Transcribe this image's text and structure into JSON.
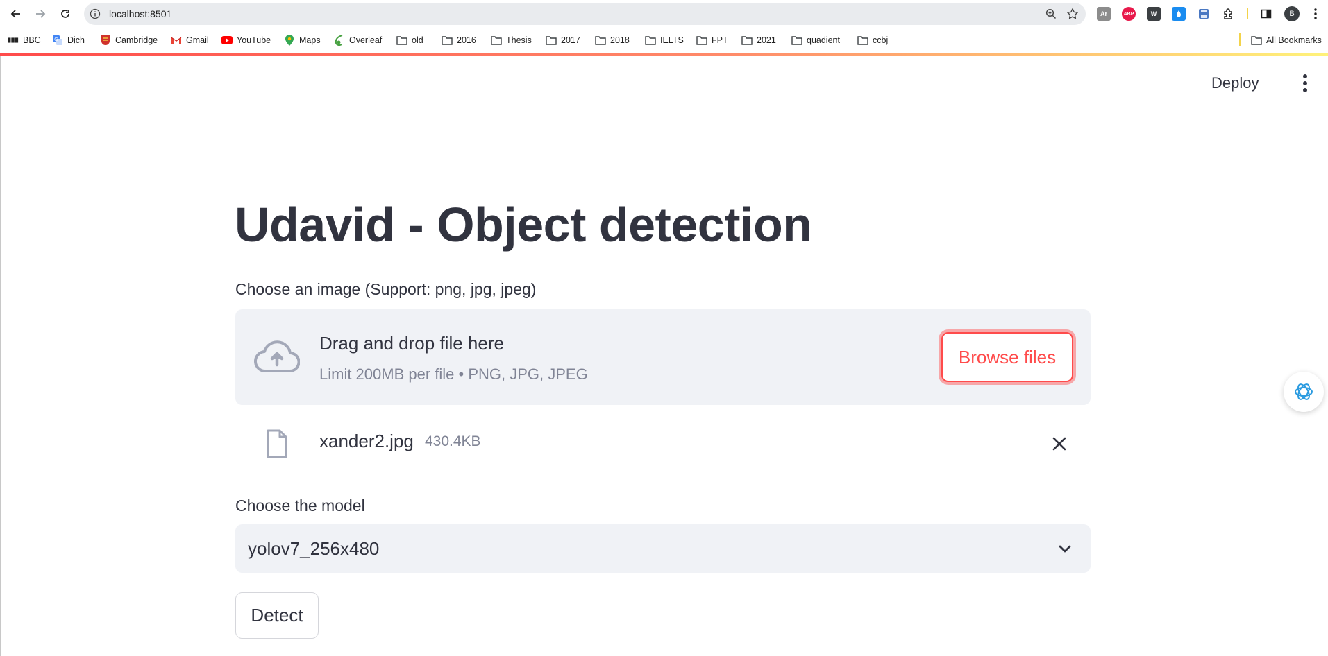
{
  "browser": {
    "url": "localhost:8501",
    "profile_initial": "B",
    "extensions": [
      {
        "name": "acrobat-extension-icon",
        "label": "Ar",
        "color": "#5f6368"
      },
      {
        "name": "adblock-plus-extension-icon",
        "label": "ABP",
        "color": "#e8194b"
      },
      {
        "name": "w-extension-icon",
        "label": "W",
        "color": "#3c4043"
      },
      {
        "name": "dropper-extension-icon",
        "label": "💧",
        "color": "#1a8cf0"
      },
      {
        "name": "save-extension-icon",
        "label": "💾",
        "color": "#4a78c2"
      }
    ],
    "bookmarks": [
      {
        "label": "BBC",
        "icon": "bbc-icon"
      },
      {
        "label": "Dịch",
        "icon": "translate-icon"
      },
      {
        "label": "Cambridge",
        "icon": "cambridge-icon"
      },
      {
        "label": "Gmail",
        "icon": "gmail-icon"
      },
      {
        "label": "YouTube",
        "icon": "youtube-icon"
      },
      {
        "label": "Maps",
        "icon": "maps-icon"
      },
      {
        "label": "Overleaf",
        "icon": "overleaf-icon"
      },
      {
        "label": "old",
        "icon": "folder-icon"
      },
      {
        "label": "2016",
        "icon": "folder-icon"
      },
      {
        "label": "Thesis",
        "icon": "folder-icon"
      },
      {
        "label": "2017",
        "icon": "folder-icon"
      },
      {
        "label": "2018",
        "icon": "folder-icon"
      },
      {
        "label": "IELTS",
        "icon": "folder-icon"
      },
      {
        "label": "FPT",
        "icon": "folder-icon"
      },
      {
        "label": "2021",
        "icon": "folder-icon"
      },
      {
        "label": "quadient",
        "icon": "folder-icon"
      },
      {
        "label": "ccbj",
        "icon": "folder-icon"
      }
    ],
    "all_bookmarks": "All Bookmarks"
  },
  "app": {
    "deploy_label": "Deploy",
    "title": "Udavid - Object detection",
    "uploader": {
      "label": "Choose an image (Support: png, jpg, jpeg)",
      "drag_text": "Drag and drop file here",
      "limit_text": "Limit 200MB per file • PNG, JPG, JPEG",
      "browse_label": "Browse files"
    },
    "uploaded_file": {
      "name": "xander2.jpg",
      "size": "430.4KB"
    },
    "model_select": {
      "label": "Choose the model",
      "value": "yolov7_256x480"
    },
    "detect_label": "Detect",
    "accent_color": "#ff4b4b"
  }
}
